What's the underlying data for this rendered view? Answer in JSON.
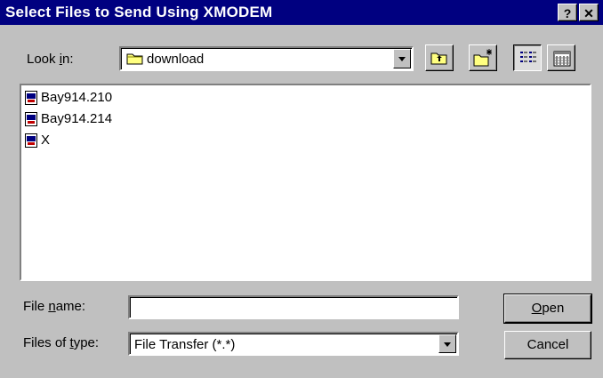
{
  "window": {
    "title": "Select Files to Send Using XMODEM",
    "help_label": "?",
    "close_label": "✕"
  },
  "look_in": {
    "label_pre": "Look ",
    "label_accel": "i",
    "label_post": "n:",
    "value": "download",
    "icon": "folder-icon"
  },
  "toolbar": {
    "up_folder_icon": "up-folder-icon",
    "new_folder_icon": "new-folder-icon",
    "list_view_icon": "list-view-icon",
    "details_view_icon": "details-view-icon"
  },
  "files": [
    {
      "name": "Bay914.210",
      "icon": "file-icon"
    },
    {
      "name": "Bay914.214",
      "icon": "file-icon"
    },
    {
      "name": "X",
      "icon": "file-icon"
    }
  ],
  "file_name": {
    "label_pre": "File ",
    "label_accel": "n",
    "label_post": "ame:",
    "value": ""
  },
  "file_type": {
    "label_pre": "Files of ",
    "label_accel": "t",
    "label_post": "ype:",
    "value": "File Transfer (*.*)"
  },
  "buttons": {
    "open_accel": "O",
    "open_rest": "pen",
    "cancel": "Cancel"
  },
  "colors": {
    "titlebar": "#000080",
    "face": "#c0c0c0",
    "folder": "#ffff80"
  }
}
